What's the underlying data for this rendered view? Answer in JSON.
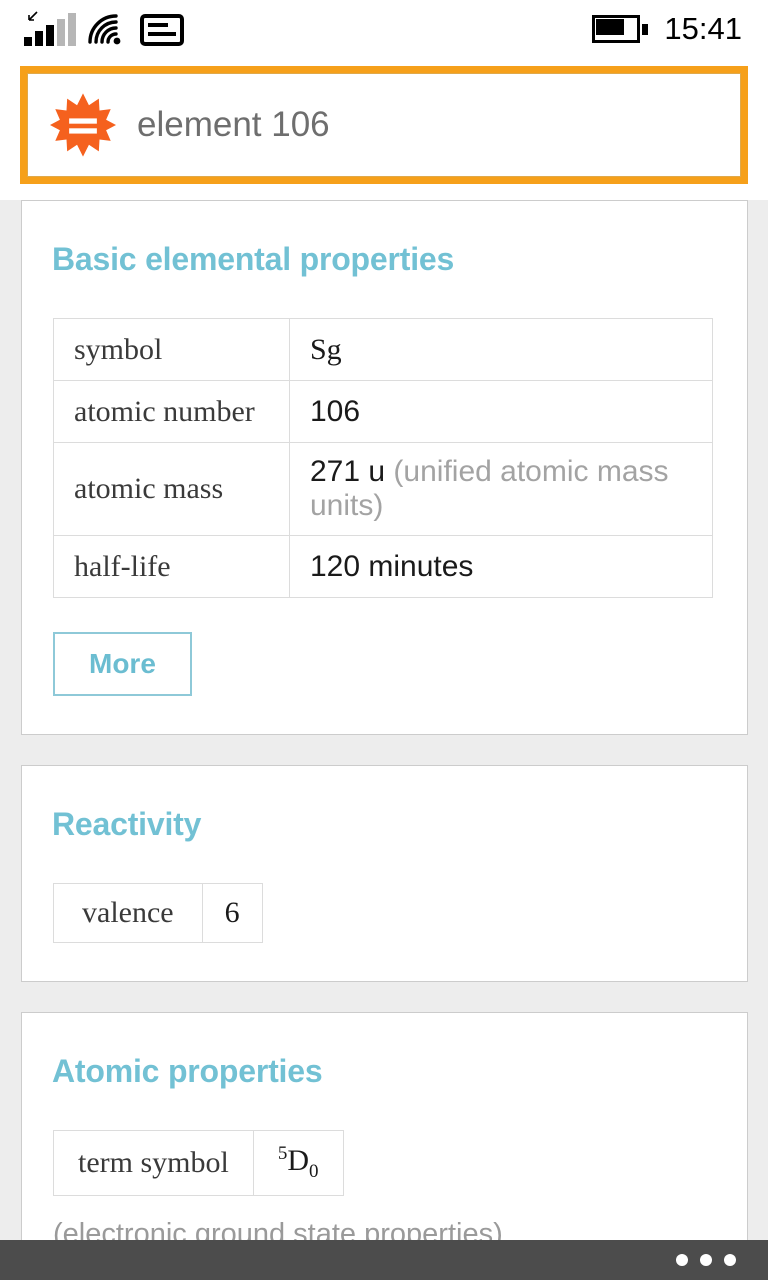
{
  "status_bar": {
    "signal_icon": "cellular-signal-icon",
    "signal_bars_filled": 3,
    "signal_bars_total": 5,
    "wifi_icon": "wifi-icon",
    "sim_icon": "sim-card-icon",
    "battery_icon": "battery-icon",
    "battery_level_percent": 65,
    "clock": "15:41"
  },
  "search": {
    "logo_icon": "wolfram-spikey-icon",
    "value": "element 106",
    "placeholder": "element 106",
    "border_color": "#f6a01a",
    "logo_color": "#f5611e"
  },
  "theme": {
    "accent": "#72c1d4",
    "page_background": "#ededed",
    "card_background": "#ffffff",
    "card_border": "#cccccc",
    "table_border": "#dcdcdc",
    "muted_text": "#a3a3a3"
  },
  "cards": [
    {
      "title": "Basic elemental properties",
      "rows": [
        {
          "label": "symbol",
          "value": "Sg",
          "value_serif": true,
          "unit": "",
          "note": ""
        },
        {
          "label": "atomic number",
          "value": "106",
          "value_serif": false,
          "unit": "",
          "note": ""
        },
        {
          "label": "atomic mass",
          "value": "271 u",
          "value_serif": false,
          "unit": "",
          "note": "(unified atomic mass units)"
        },
        {
          "label": "half-life",
          "value": "120 minutes",
          "value_serif": false,
          "unit": "",
          "note": ""
        }
      ],
      "button": "More"
    },
    {
      "title": "Reactivity",
      "rows": [
        {
          "label": "valence",
          "value": "6",
          "value_serif": true,
          "unit": "",
          "note": ""
        }
      ],
      "button": ""
    },
    {
      "title": "Atomic properties",
      "rows": [
        {
          "label": "term symbol",
          "value": "5D0",
          "value_serif": true,
          "unit": "",
          "note": ""
        }
      ],
      "button": "",
      "footnote": "(electronic ground state properties)"
    }
  ],
  "term_symbol": {
    "superscript": "5",
    "letter": "D",
    "subscript": "0"
  },
  "bottom_bar": {
    "more_icon": "ellipsis-icon",
    "background": "#4c4c4c"
  }
}
